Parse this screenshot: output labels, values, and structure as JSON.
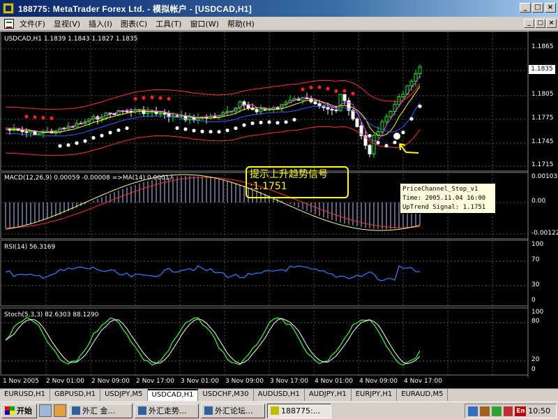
{
  "window": {
    "title": "188775: MetaTrader   Forex Ltd. - 模拟帐户 - [USDCAD,H1]",
    "min": "_",
    "max": "□",
    "close": "×"
  },
  "menu": {
    "items": [
      "文件(F)",
      "显视(V)",
      "插入(I)",
      "图表(C)",
      "工具(T)",
      "窗口(W)",
      "帮助(H)"
    ]
  },
  "main_pane": {
    "label": "USDCAD,H1  1.1839 1.1843 1.1827 1.1835",
    "price_levels": [
      "1.1865",
      "1.1805",
      "1.1775",
      "1.1745",
      "1.1715"
    ],
    "current_price": "1.1835",
    "annotation_line1": "提示上升趋势信号",
    "annotation_line2": ":1.1751",
    "info_line1": "PriceChannel_Stop_v1",
    "info_line2": "Time: 2005.11.04 16:00",
    "info_line3": "UpTrend Signal: 1.1751"
  },
  "macd_pane": {
    "label": "MACD(12,26,9) 0.00059 -0.00008  =>MA(14) 0.00017",
    "levels": [
      "0.00103",
      "0.00",
      "-0.00122"
    ]
  },
  "rsi_pane": {
    "label": "RSI(14) 56.3169",
    "levels": [
      "100",
      "70",
      "30",
      "0"
    ]
  },
  "stoch_pane": {
    "label": "Stoch(5,3,3) 82.6303 88.1290",
    "levels": [
      "100",
      "80",
      "20",
      "0"
    ]
  },
  "time_axis": [
    "1 Nov 2005",
    "2 Nov 01:00",
    "2 Nov 09:00",
    "2 Nov 17:00",
    "3 Nov 01:00",
    "3 Nov 09:00",
    "3 Nov 17:00",
    "4 Nov 01:00",
    "4 Nov 09:00",
    "4 Nov 17:00"
  ],
  "tabs": [
    "EURUSD,H1",
    "GBPUSD,H1",
    "USDJPY,M5",
    "USDCAD,H1",
    "USDCHF,M30",
    "AUDUSD,H1",
    "AUDJPY,H1",
    "EURJPY,H1",
    "EURAUD,M5"
  ],
  "active_tab": "USDCAD,H1",
  "taskbar": {
    "start": "开始",
    "tasks": [
      "外汇 金...",
      "外汇走势...",
      "外汇论坛...",
      "188775:..."
    ],
    "lang": "En",
    "clock": "10:50"
  },
  "colors": {
    "bull_candle": "#00ff00",
    "bear_candle": "#ffffff",
    "upper_band": "#ff3030",
    "ma_line": "#ffff00",
    "stop_dots": "#ffffff",
    "stop_dots_red": "#ff2020",
    "macd_hist": "#c0c0ff",
    "signal": "#ff3030",
    "rsi": "#3080ff",
    "stoch_main": "#30ff30",
    "stoch_signal": "#ffffff",
    "annotation": "#ffff00"
  }
}
